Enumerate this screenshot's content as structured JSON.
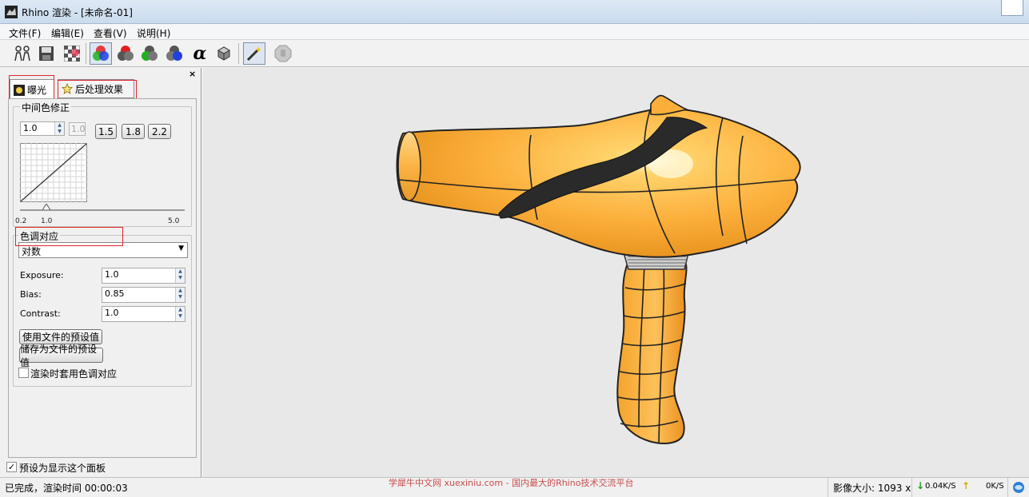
{
  "window": {
    "title": "Rhino 渲染 - [未命名-01]"
  },
  "menu": [
    {
      "label": "文件(F)"
    },
    {
      "label": "编辑(E)"
    },
    {
      "label": "查看(V)"
    },
    {
      "label": "说明(H)"
    }
  ],
  "toolbar": {
    "icons": [
      "people-icon",
      "save-icon",
      "checker-icon",
      "rgb-channels-icon",
      "red-channel-icon",
      "green-channel-icon",
      "blue-channel-icon",
      "alpha-icon",
      "cube-icon",
      "magic-wand-icon",
      "stop-hand-icon"
    ],
    "alpha_glyph": "α"
  },
  "panel": {
    "close_glyph": "×",
    "tabs": [
      {
        "label": "曝光",
        "active": true
      },
      {
        "label": "后处理效果",
        "active": false
      }
    ],
    "gamma": {
      "title": "中间色修正",
      "value": "1.0",
      "disabled_value": "1.0",
      "presets": [
        "1.5",
        "1.8",
        "2.2"
      ],
      "slider_min": "0.2",
      "slider_mid": "1.0",
      "slider_max": "5.0"
    },
    "tone": {
      "title": "色调对应",
      "method": "对数",
      "fields": [
        {
          "label": "Exposure:",
          "value": "1.0"
        },
        {
          "label": "Bias:",
          "value": "0.85"
        },
        {
          "label": "Contrast:",
          "value": "1.0"
        }
      ],
      "use_defaults": "使用文件的预设值",
      "save_defaults": "储存为文件的预设值",
      "apply_checkbox": "渲染时套用色调对应",
      "apply_checked": false
    },
    "show_default": "预设为显示这个面板",
    "show_default_checked": true
  },
  "status": {
    "left": "已完成，渲染时间 00:00:03",
    "watermark": "学犀牛中文网 xuexiniu.com - 国内最大的Rhino技术交流平台",
    "image_size": "影像大小: 1093 x",
    "down_speed": "0.04K/S",
    "up_speed": "0K/S",
    "down_arrow": "↓",
    "up_arrow": "↑"
  },
  "colors": {
    "accent_red": "#e0242c",
    "render_bg": "#e8e8e8",
    "dryer_orange": "#fcae3a"
  }
}
